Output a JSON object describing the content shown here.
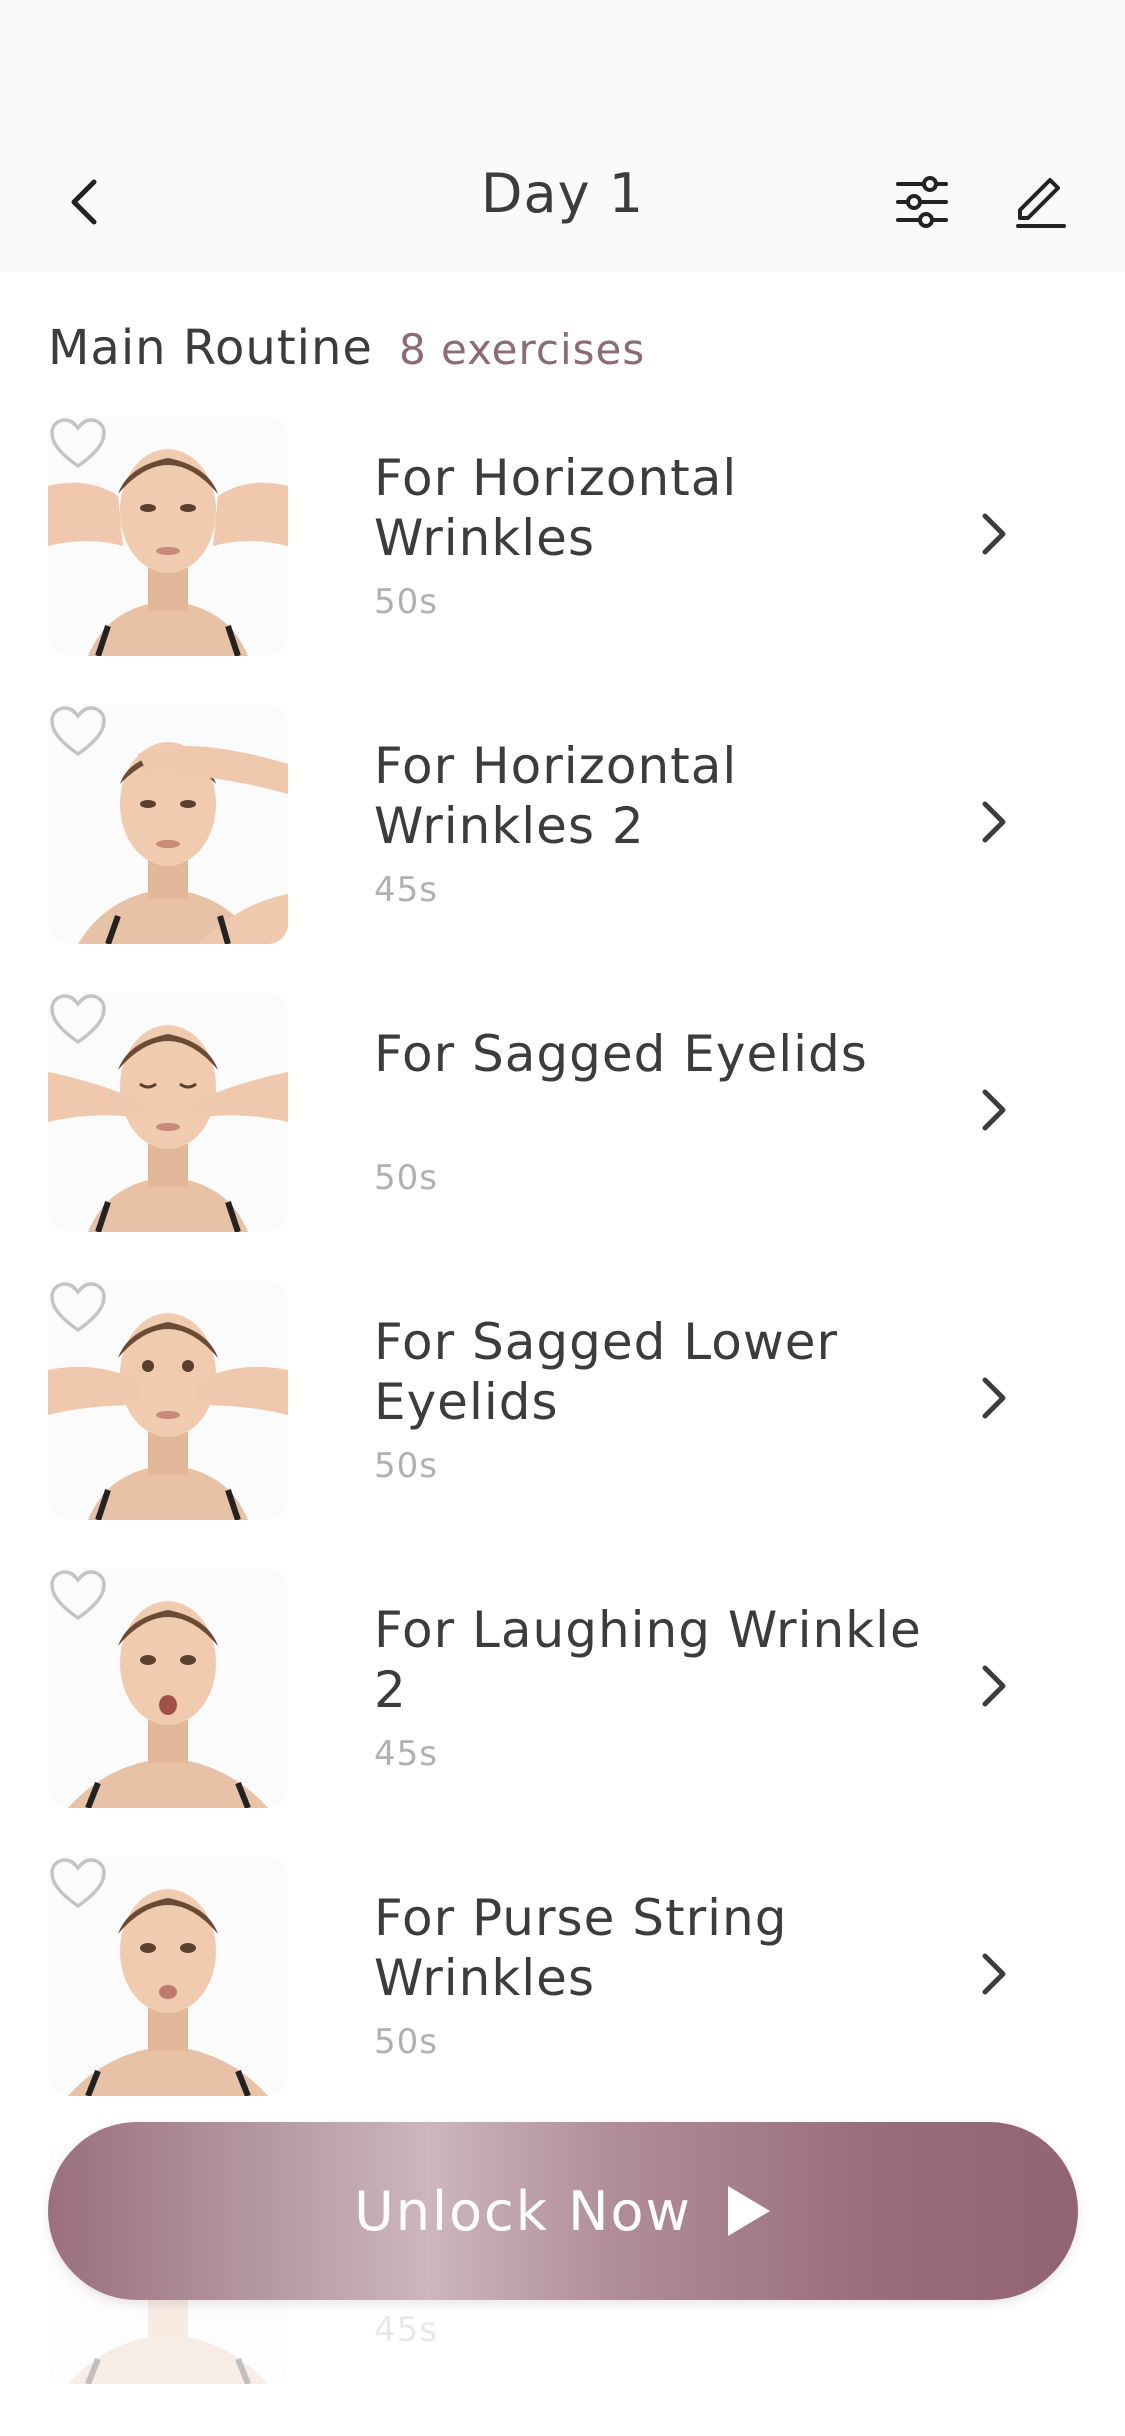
{
  "nav": {
    "title": "Day 1"
  },
  "section": {
    "title": "Main Routine",
    "count_label": "8 exercises"
  },
  "exercises": [
    {
      "title": "For Horizontal Wrinkles",
      "duration": "50s"
    },
    {
      "title": "For Horizontal Wrinkles 2",
      "duration": "45s"
    },
    {
      "title": "For Sagged Eyelids",
      "duration": "50s"
    },
    {
      "title": "For Sagged Lower Eyelids",
      "duration": "50s"
    },
    {
      "title": "For Laughing Wrinkle 2",
      "duration": "45s"
    },
    {
      "title": "For Purse String Wrinkles",
      "duration": "50s"
    },
    {
      "title": "",
      "duration": "45s"
    }
  ],
  "cta": {
    "label": "Unlock Now"
  },
  "colors": {
    "accent": "#8d6a78",
    "cta_gradient_start": "#9b6f7e",
    "cta_gradient_mid": "#cdb6bd",
    "cta_gradient_end": "#916473"
  },
  "icons": {
    "back": "chevron-left-icon",
    "filter": "sliders-icon",
    "edit": "pencil-icon",
    "favorite": "heart-outline-icon",
    "row_action": "chevron-right-icon",
    "play": "play-icon"
  }
}
